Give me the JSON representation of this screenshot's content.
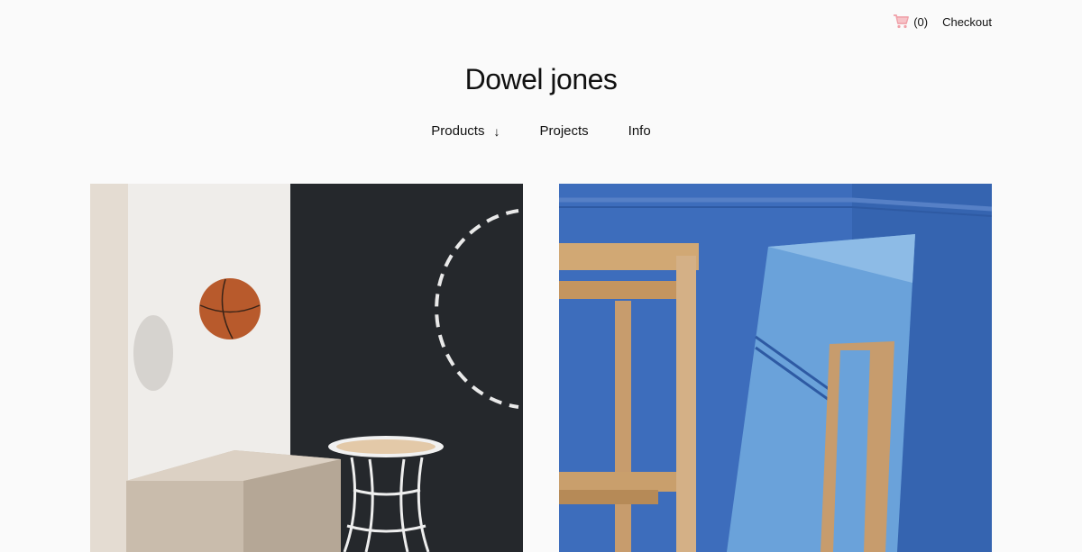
{
  "header": {
    "cart_count": "(0)",
    "checkout_label": "Checkout",
    "brand": "Dowel jones"
  },
  "nav": {
    "items": [
      {
        "label": "Products",
        "icon": "↓"
      },
      {
        "label": "Projects"
      },
      {
        "label": "Info"
      }
    ]
  },
  "products": [
    {
      "image": "basketball-and-stool-scene",
      "colors": {
        "dark_wall": "#25282c",
        "light_wall": "#efedea",
        "beige": "#c9bcac"
      }
    },
    {
      "image": "timber-frame-and-mirror-scene",
      "colors": {
        "wall": "#3d6dbc",
        "timber": "#c79c6d"
      }
    }
  ],
  "colors": {
    "cart_icon": "#f0a0a8",
    "background": "#fafafa"
  }
}
